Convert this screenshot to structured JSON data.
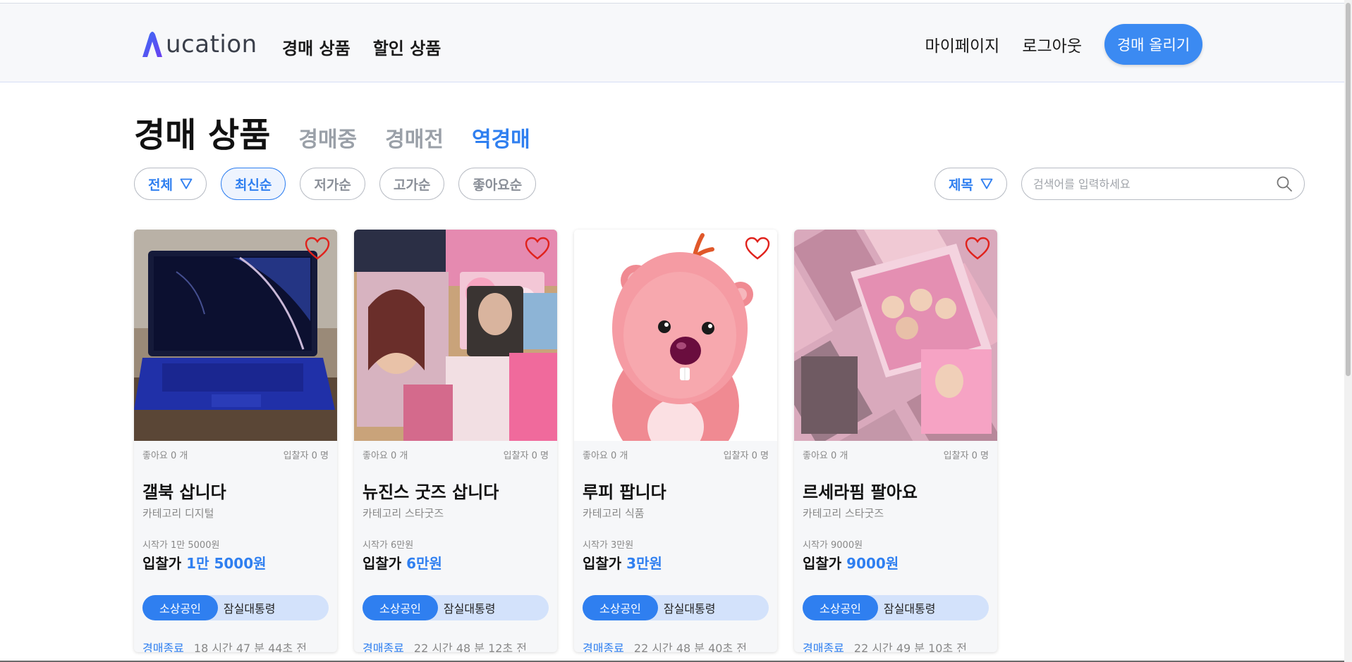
{
  "header": {
    "logo_text": "ucation",
    "nav": [
      "경매 상품",
      "할인 상품"
    ],
    "mypage": "마이페이지",
    "logout": "로그아웃",
    "upload_button": "경매 올리기",
    "accent_color": "#3b8af2"
  },
  "page": {
    "title": "경매 상품",
    "tabs": [
      {
        "label": "경매중",
        "active": false
      },
      {
        "label": "경매전",
        "active": false
      },
      {
        "label": "역경매",
        "active": true
      }
    ]
  },
  "filters": {
    "category": "전체",
    "sorts": [
      {
        "label": "최신순",
        "selected": true
      },
      {
        "label": "저가순",
        "selected": false
      },
      {
        "label": "고가순",
        "selected": false
      },
      {
        "label": "좋아요순",
        "selected": false
      }
    ],
    "search_field": "제목",
    "search_placeholder": "검색어를 입력하세요"
  },
  "cards": [
    {
      "image": "laptop",
      "likes": "좋아요 0 개",
      "bidders": "입찰자 0 명",
      "title": "갤북 삽니다",
      "category": "카테고리 디지털",
      "start_price": "시작가 1만 5000원",
      "bid_label": "입찰가 ",
      "bid_amount": "1만 5000원",
      "tag1": "소상공인",
      "tag2": "잠실대통령",
      "end_label": "경매종료",
      "end_time": "18 시간 47 분 44초 전"
    },
    {
      "image": "newjeans-goods",
      "likes": "좋아요 0 개",
      "bidders": "입찰자 0 명",
      "title": "뉴진스 굿즈 삽니다",
      "category": "카테고리 스타굿즈",
      "start_price": "시작가 6만원",
      "bid_label": "입찰가 ",
      "bid_amount": "6만원",
      "tag1": "소상공인",
      "tag2": "잠실대통령",
      "end_label": "경매종료",
      "end_time": "22 시간 48 분 12초 전"
    },
    {
      "image": "loopy",
      "likes": "좋아요 0 개",
      "bidders": "입찰자 0 명",
      "title": "루피 팝니다",
      "category": "카테고리 식품",
      "start_price": "시작가 3만원",
      "bid_label": "입찰가 ",
      "bid_amount": "3만원",
      "tag1": "소상공인",
      "tag2": "잠실대통령",
      "end_label": "경매종료",
      "end_time": "22 시간 48 분 40초 전"
    },
    {
      "image": "lesserafim-cards",
      "likes": "좋아요 0 개",
      "bidders": "입찰자 0 명",
      "title": "르세라핌 팔아요",
      "category": "카테고리 스타굿즈",
      "start_price": "시작가 9000원",
      "bid_label": "입찰가 ",
      "bid_amount": "9000원",
      "tag1": "소상공인",
      "tag2": "잠실대통령",
      "end_label": "경매종료",
      "end_time": "22 시간 49 분 10초 전"
    }
  ]
}
